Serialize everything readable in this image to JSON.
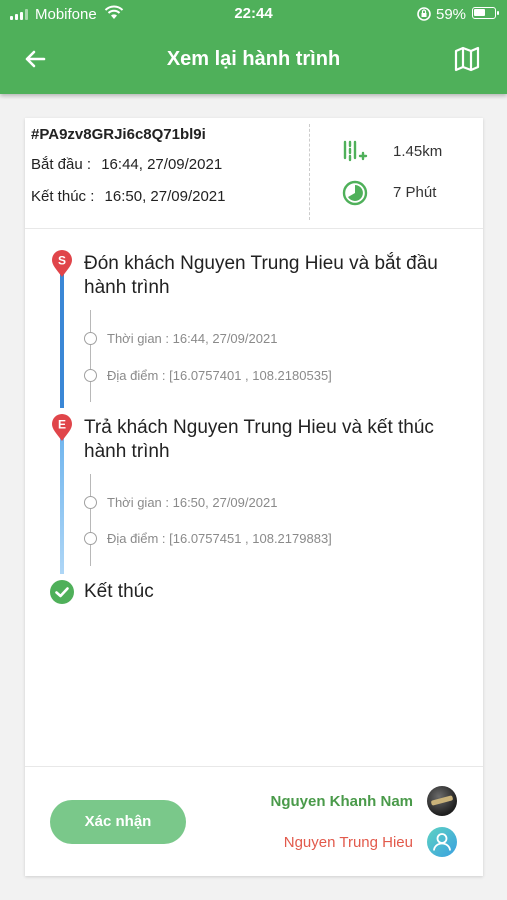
{
  "status_bar": {
    "carrier": "Mobifone",
    "time": "22:44",
    "battery_percent": "59%",
    "battery_level": 0.59
  },
  "header": {
    "title": "Xem lại hành trình",
    "back_icon": "arrow-left-icon",
    "map_icon": "map-icon"
  },
  "trip": {
    "id": "#PA9zv8GRJi6c8Q71bl9i",
    "start_label": "Bắt đầu  :",
    "start_value": "16:44, 27/09/2021",
    "end_label": "Kết thúc :",
    "end_value": "16:50, 27/09/2021",
    "distance": "1.45km",
    "duration": "7 Phút"
  },
  "timeline": {
    "start_event": {
      "marker": "S",
      "title": "Đón khách Nguyen Trung Hieu và bắt đầu hành trình",
      "time": "Thời gian : 16:44, 27/09/2021",
      "location": "Địa điểm : [16.0757401 , 108.2180535]"
    },
    "end_event": {
      "marker": "E",
      "title": "Trả khách Nguyen Trung Hieu và kết thúc hành trình",
      "time": "Thời gian : 16:50, 27/09/2021",
      "location": "Địa điểm : [16.0757451 , 108.2179883]"
    },
    "finish_label": "Kết thúc"
  },
  "footer": {
    "confirm_label": "Xác nhận",
    "driver_name": "Nguyen Khanh Nam",
    "customer_name": "Nguyen Trung Hieu"
  },
  "colors": {
    "primary_green": "#4fb05a",
    "timeline_blue": "#3a87d6",
    "marker_red": "#e0454a",
    "customer_red": "#e25a4c",
    "confirm_green": "#7ac88a"
  }
}
